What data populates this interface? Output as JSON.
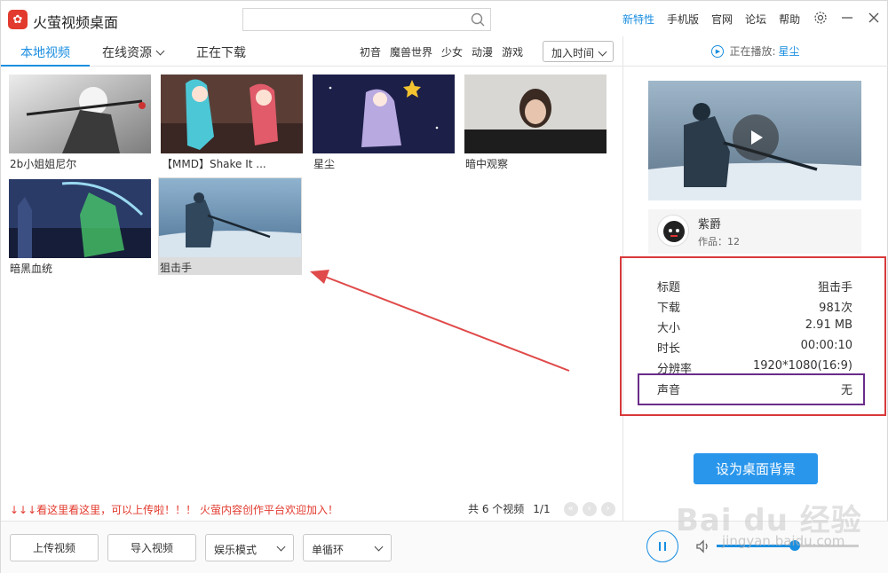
{
  "app": {
    "title": "火萤视频桌面",
    "logo_icon": "firefly-logo-icon"
  },
  "search": {
    "placeholder": ""
  },
  "top_links": [
    {
      "label": "新特性",
      "accent": true
    },
    {
      "label": "手机版",
      "accent": false
    },
    {
      "label": "官网",
      "accent": false
    },
    {
      "label": "论坛",
      "accent": false
    },
    {
      "label": "帮助",
      "accent": false
    }
  ],
  "tabs": [
    {
      "label": "本地视频",
      "active": true
    },
    {
      "label": "在线资源",
      "active": false
    },
    {
      "label": "正在下载",
      "active": false
    }
  ],
  "categories": [
    "初音",
    "魔兽世界",
    "少女",
    "动漫",
    "游戏"
  ],
  "sort": {
    "selected": "加入时间"
  },
  "videos": [
    {
      "label": "2b小姐姐尼尔",
      "selected": false
    },
    {
      "label": "【MMD】Shake It ...",
      "selected": false
    },
    {
      "label": "星尘",
      "selected": false
    },
    {
      "label": "暗中观察",
      "selected": false
    },
    {
      "label": "暗黑血统",
      "selected": false
    },
    {
      "label": "狙击手",
      "selected": true
    }
  ],
  "promo": "↓↓↓看这里看这里，可以上传啦！！！ 火萤内容创作平台欢迎加入！",
  "pager": {
    "count": "共 6 个视频",
    "page": "1/1"
  },
  "bottom": {
    "upload": "上传视频",
    "import": "导入视频",
    "mode": "娱乐模式",
    "loop": "单循环"
  },
  "now_playing": {
    "label": "正在播放:",
    "title": "星尘"
  },
  "author": {
    "name": "紫爵",
    "works": "作品：12"
  },
  "info": [
    {
      "key": "标题",
      "value": "狙击手"
    },
    {
      "key": "下载",
      "value": "981次"
    },
    {
      "key": "大小",
      "value": "2.91 MB"
    },
    {
      "key": "时长",
      "value": "00:00:10"
    },
    {
      "key": "分辨率",
      "value": "1920*1080(16:9)"
    },
    {
      "key": "声音",
      "value": "无"
    }
  ],
  "set_background": "设为桌面背景",
  "player": {
    "volume": 0.55
  },
  "watermark": {
    "text": "Bai du 经验",
    "url": "jingyan.baidu.com"
  },
  "colors": {
    "accent": "#1a8ee0",
    "red_box": "#d8393b",
    "purple_box": "#6a2c8a",
    "button": "#2996ec"
  }
}
